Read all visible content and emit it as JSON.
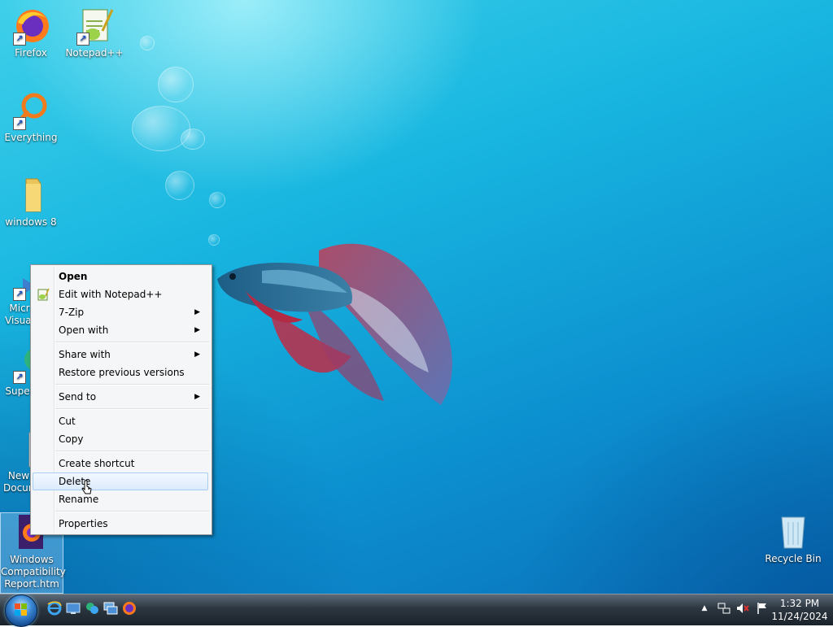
{
  "desktop": {
    "icons": [
      {
        "label": "Firefox"
      },
      {
        "label": "Notepad++"
      },
      {
        "label": "Everything"
      },
      {
        "label": "windows 8"
      },
      {
        "label": "Micr Visual"
      },
      {
        "label": "Super"
      },
      {
        "label": "New Docum"
      },
      {
        "label": "Windows Compatibility Report.htm"
      },
      {
        "label": "Recycle Bin"
      }
    ]
  },
  "context_menu": {
    "items": [
      {
        "label": "Open"
      },
      {
        "label": "Edit with Notepad++"
      },
      {
        "label": "7-Zip"
      },
      {
        "label": "Open with"
      },
      {
        "label": "Share with"
      },
      {
        "label": "Restore previous versions"
      },
      {
        "label": "Send to"
      },
      {
        "label": "Cut"
      },
      {
        "label": "Copy"
      },
      {
        "label": "Create shortcut"
      },
      {
        "label": "Delete"
      },
      {
        "label": "Rename"
      },
      {
        "label": "Properties"
      }
    ]
  },
  "taskbar": {
    "clock_time": "1:32 PM",
    "clock_date": "11/24/2024",
    "quicklaunch": [
      "internet-explorer-icon",
      "show-desktop-icon",
      "messenger-icon",
      "switch-windows-icon",
      "firefox-icon"
    ],
    "tray": [
      "show-hidden-icons-arrow",
      "network-icon",
      "volume-muted-icon",
      "action-center-flag-icon"
    ]
  },
  "colors": {
    "desktop_accent": "#18b6e0",
    "menu_hover": "#dcebfc",
    "taskbar": "#2c3640"
  }
}
